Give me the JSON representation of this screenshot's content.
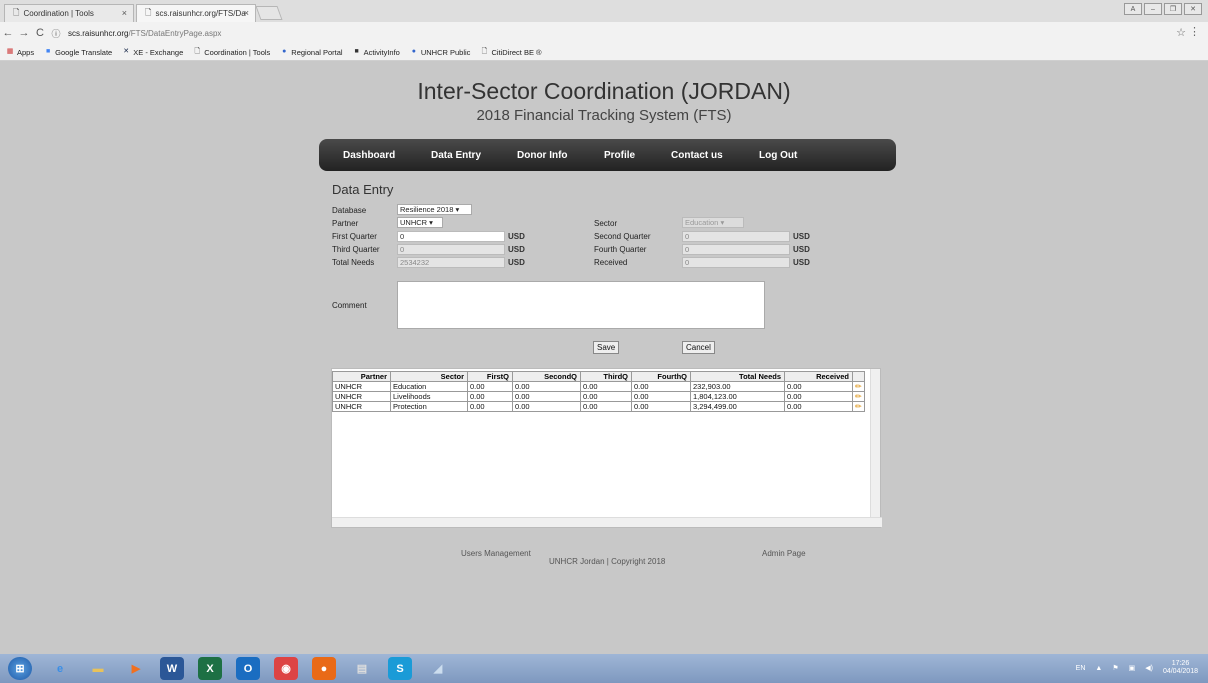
{
  "browser": {
    "tabs": [
      {
        "label": "Coordination | Tools"
      },
      {
        "label": "scs.raisunhcr.org/FTS/Da"
      }
    ],
    "url_host": "scs.raisunhcr.org",
    "url_path": "/FTS/DataEntryPage.aspx",
    "bookmarks": [
      {
        "label": "Apps"
      },
      {
        "label": "Google Translate"
      },
      {
        "label": "XE - Exchange"
      },
      {
        "label": "Coordination | Tools"
      },
      {
        "label": "Regional Portal"
      },
      {
        "label": "ActivityInfo"
      },
      {
        "label": "UNHCR Public"
      },
      {
        "label": "CitiDirect BE ®"
      }
    ]
  },
  "header": {
    "title": "Inter-Sector Coordination (JORDAN)",
    "subtitle": "2018 Financial Tracking System (FTS)"
  },
  "nav": {
    "items": [
      {
        "label": "Dashboard"
      },
      {
        "label": "Data Entry"
      },
      {
        "label": "Donor Info"
      },
      {
        "label": "Profile"
      },
      {
        "label": "Contact us"
      },
      {
        "label": "Log Out"
      }
    ]
  },
  "form": {
    "title": "Data Entry",
    "database_label": "Database",
    "database_value": "Resilience 2018",
    "partner_label": "Partner",
    "partner_value": "UNHCR",
    "sector_label": "Sector",
    "sector_value": "Education",
    "first_quarter_label": "First Quarter",
    "first_quarter_value": "0",
    "second_quarter_label": "Second Quarter",
    "second_quarter_value": "0",
    "third_quarter_label": "Third Quarter",
    "third_quarter_value": "0",
    "fourth_quarter_label": "Fourth Quarter",
    "fourth_quarter_value": "0",
    "total_needs_label": "Total Needs",
    "total_needs_value": "2534232",
    "received_label": "Received",
    "received_value": "0",
    "currency": "USD",
    "comment_label": "Comment",
    "save_label": "Save",
    "cancel_label": "Cancel"
  },
  "grid": {
    "columns": [
      "Partner",
      "Sector",
      "FirstQ",
      "SecondQ",
      "ThirdQ",
      "FourthQ",
      "Total Needs",
      "Received"
    ],
    "rows": [
      [
        "UNHCR",
        "Education",
        "0.00",
        "0.00",
        "0.00",
        "0.00",
        "232,903.00",
        "0.00"
      ],
      [
        "UNHCR",
        "Livelihoods",
        "0.00",
        "0.00",
        "0.00",
        "0.00",
        "1,804,123.00",
        "0.00"
      ],
      [
        "UNHCR",
        "Protection",
        "0.00",
        "0.00",
        "0.00",
        "0.00",
        "3,294,499.00",
        "0.00"
      ]
    ]
  },
  "footer": {
    "users_management": "Users Management",
    "admin_page": "Admin Page",
    "copyright": "UNHCR Jordan | Copyright 2018"
  },
  "taskbar": {
    "lang": "EN",
    "time": "17:26",
    "date": "04/04/2018"
  }
}
